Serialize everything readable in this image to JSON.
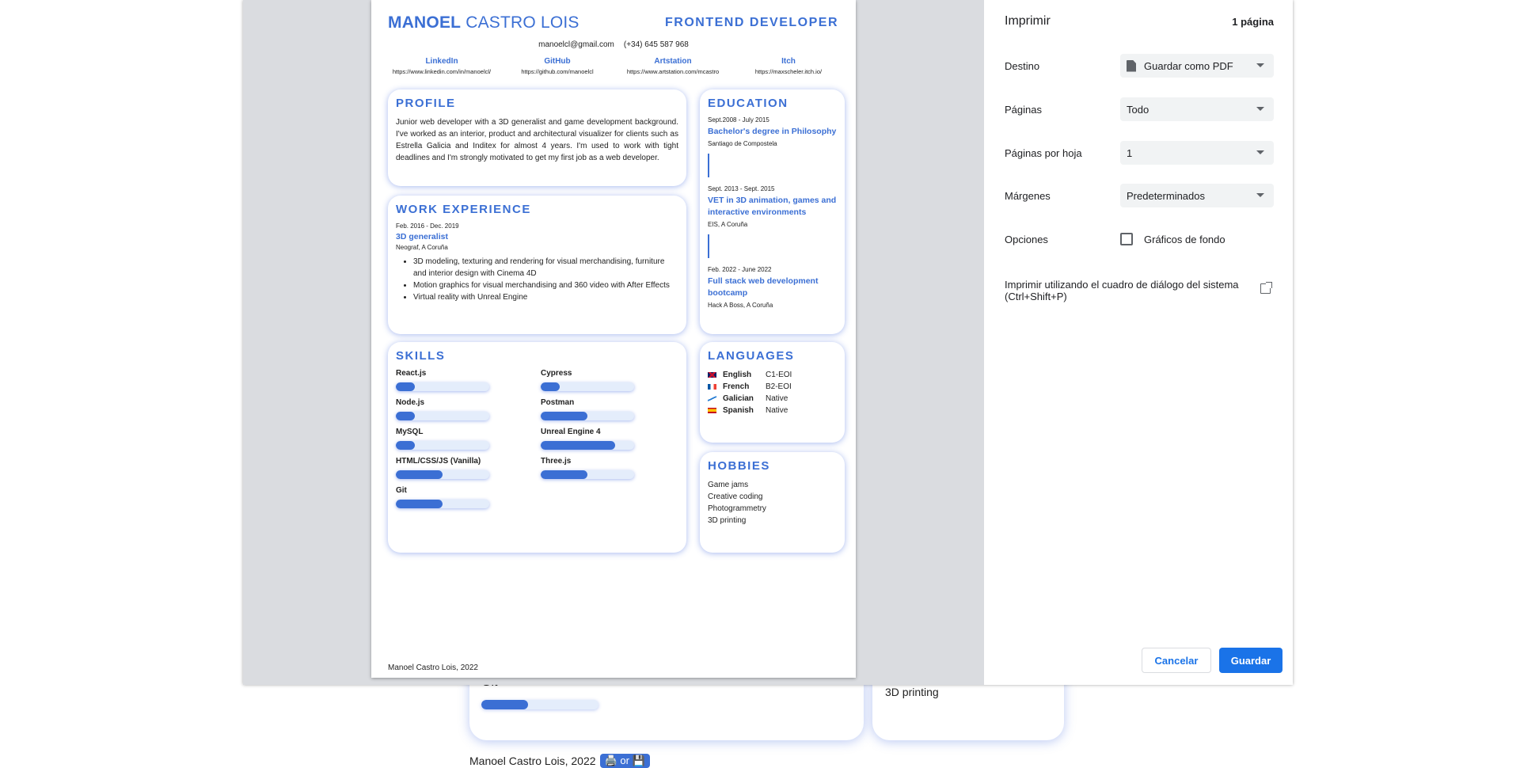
{
  "background_page": {
    "git_label": "Git",
    "git_level": 0.4,
    "hobby_3d": "3D printing",
    "footer_text": "Manoel Castro Lois, 2022",
    "footer_pill": "🖨️ or 💾"
  },
  "print_dialog": {
    "title": "Imprimir",
    "page_count": "1 página",
    "destination": {
      "label": "Destino",
      "value": "Guardar como PDF",
      "icon": "document-icon"
    },
    "pages": {
      "label": "Páginas",
      "value": "Todo"
    },
    "pages_per_sheet": {
      "label": "Páginas por hoja",
      "value": "1"
    },
    "margins": {
      "label": "Márgenes",
      "value": "Predeterminados"
    },
    "options": {
      "label": "Opciones",
      "checkbox_label": "Gráficos de fondo",
      "checked": false
    },
    "system_dialog": "Imprimir utilizando el cuadro de diálogo del sistema (Ctrl+Shift+P)",
    "cancel_label": "Cancelar",
    "save_label": "Guardar",
    "accent_color": "#1a73e8"
  },
  "resume": {
    "name_first": "MANOEL",
    "name_rest": " CASTRO LOIS",
    "role": "FRONTEND DEVELOPER",
    "email": "manoelcl@gmail.com",
    "phone": "(+34) 645 587 968",
    "links": [
      {
        "name": "LinkedIn",
        "url": "https://www.linkedin.com/in/manoelcl/"
      },
      {
        "name": "GitHub",
        "url": "https://github.com/manoelcl"
      },
      {
        "name": "Artstation",
        "url": "https://www.artstation.com/mcastro"
      },
      {
        "name": "Itch",
        "url": "https://maxscheler.itch.io/"
      }
    ],
    "profile": {
      "title": "PROFILE",
      "text": "Junior web developer with a 3D generalist and game development background. I've worked as an interior, product and architectural visualizer for clients such as Estrella Galicia and Inditex for almost 4 years. I'm used to work with tight deadlines and I'm strongly motivated to get my first job as a web developer."
    },
    "work": {
      "title": "WORK EXPERIENCE",
      "date": "Feb. 2016 - Dec. 2019",
      "position": "3D generalist",
      "company": "Neograf, A Coruña",
      "bullets": [
        "3D modeling, texturing and rendering for visual merchandising, furniture and interior design with Cinema 4D",
        "Motion graphics for visual merchandising and 360 video with After Effects",
        "Virtual reality with Unreal Engine"
      ]
    },
    "education": {
      "title": "EDUCATION",
      "items": [
        {
          "date": "Sept.2008 - July 2015",
          "degree": "Bachelor's degree in Philosophy",
          "place": "Santiago de Compostela"
        },
        {
          "date": "Sept. 2013 - Sept. 2015",
          "degree": "VET in 3D animation, games and interactive environments",
          "place": "EIS, A Coruña"
        },
        {
          "date": "Feb. 2022 - June 2022",
          "degree": "Full stack web development bootcamp",
          "place": "Hack A Boss, A Coruña"
        }
      ]
    },
    "skills": {
      "title": "SKILLS",
      "items": [
        {
          "name": "React.js",
          "level": 0.2
        },
        {
          "name": "Cypress",
          "level": 0.2
        },
        {
          "name": "Node.js",
          "level": 0.2
        },
        {
          "name": "Postman",
          "level": 0.5
        },
        {
          "name": "MySQL",
          "level": 0.2
        },
        {
          "name": "Unreal Engine 4",
          "level": 0.8
        },
        {
          "name": "HTML/CSS/JS (Vanilla)",
          "level": 0.5
        },
        {
          "name": "Three.js",
          "level": 0.5
        },
        {
          "name": "Git",
          "level": 0.5
        }
      ]
    },
    "languages": {
      "title": "LANGUAGES",
      "items": [
        {
          "name": "English",
          "level": "C1-EOI",
          "flag": "uk-flag-icon"
        },
        {
          "name": "French",
          "level": "B2-EOI",
          "flag": "france-flag-icon"
        },
        {
          "name": "Galician",
          "level": "Native",
          "flag": "galicia-flag-icon"
        },
        {
          "name": "Spanish",
          "level": "Native",
          "flag": "spain-flag-icon"
        }
      ]
    },
    "hobbies": {
      "title": "HOBBIES",
      "items": [
        "Game jams",
        "Creative coding",
        "Photogrammetry",
        "3D printing"
      ]
    },
    "footer": "Manoel Castro Lois, 2022",
    "accent_color": "#3b6fd4"
  }
}
